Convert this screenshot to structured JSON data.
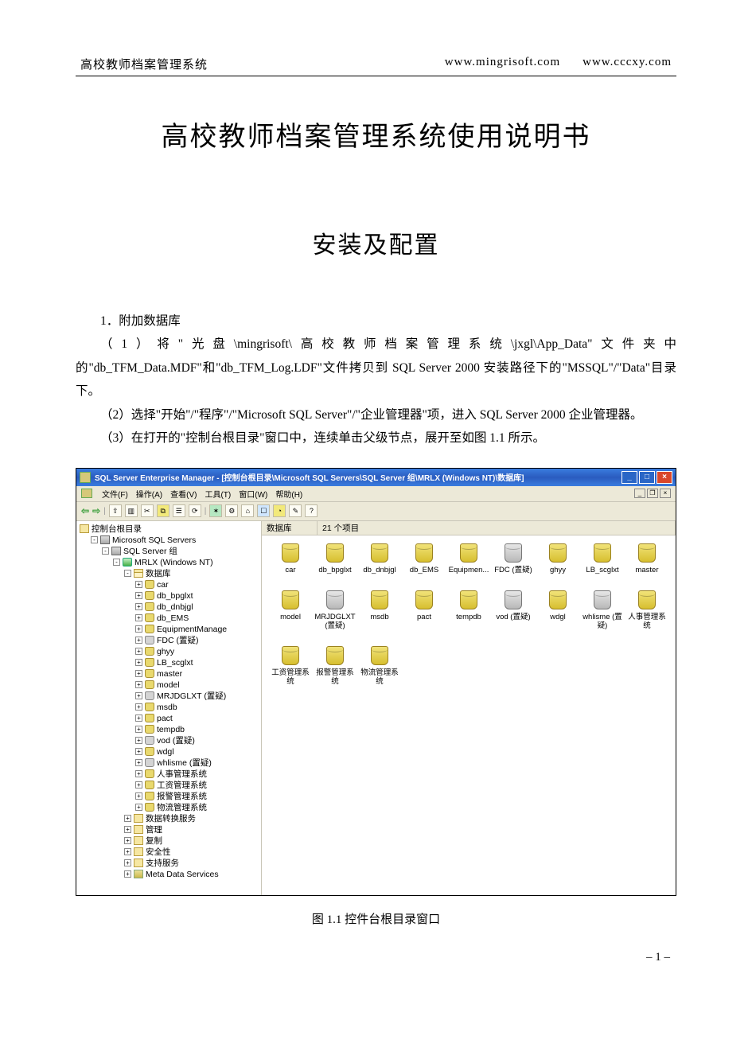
{
  "header": {
    "left": "高校教师档案管理系统",
    "url1": "www.mingrisoft.com",
    "url2": "www.cccxy.com"
  },
  "title": "高校教师档案管理系统使用说明书",
  "subtitle": "安装及配置",
  "section_num": "1．附加数据库",
  "p1": "（1）将\"光盘\\mingrisoft\\高校教师档案管理系统\\jxgl\\App_Data\"文件夹中的\"db_TFM_Data.MDF\"和\"db_TFM_Log.LDF\"文件拷贝到 SQL Server 2000 安装路径下的\"MSSQL\"/\"Data\"目录下。",
  "p2": "（2）选择\"开始\"/\"程序\"/\"Microsoft SQL Server\"/\"企业管理器\"项，进入 SQL Server 2000 企业管理器。",
  "p3": "（3）在打开的\"控制台根目录\"窗口中，连续单击父级节点，展开至如图 1.1 所示。",
  "fig_caption": "图 1.1    控件台根目录窗口",
  "page_number": "– 1 –",
  "ss": {
    "title": "SQL Server Enterprise Manager - [控制台根目录\\Microsoft SQL Servers\\SQL Server 组\\MRLX (Windows NT)\\数据库]",
    "menu": {
      "file": "文件(F)",
      "action": "操作(A)",
      "view": "查看(V)",
      "tools": "工具(T)",
      "window": "窗口(W)",
      "help": "帮助(H)"
    },
    "list_hdr": {
      "c1": "数据库",
      "c2": "21 个项目"
    },
    "tree": {
      "root": "控制台根目录",
      "n1": "Microsoft SQL Servers",
      "n2": "SQL Server 组",
      "n3": "MRLX (Windows NT)",
      "n4": "数据库",
      "dbs": [
        "car",
        "db_bpglxt",
        "db_dnbjgl",
        "db_EMS",
        "EquipmentManage",
        "FDC (置疑)",
        "ghyy",
        "LB_scglxt",
        "master",
        "model",
        "MRJDGLXT (置疑)",
        "msdb",
        "pact",
        "tempdb",
        "vod (置疑)",
        "wdgl",
        "whlisme (置疑)",
        "人事管理系统",
        "工资管理系统",
        "报警管理系统",
        "物流管理系统"
      ],
      "f1": "数据转换服务",
      "f2": "管理",
      "f3": "复制",
      "f4": "安全性",
      "f5": "支持服务",
      "f6": "Meta Data Services"
    },
    "icons": {
      "row1": [
        {
          "n": "car",
          "g": 0
        },
        {
          "n": "db_bpglxt",
          "g": 0
        },
        {
          "n": "db_dnbjgl",
          "g": 0
        },
        {
          "n": "db_EMS",
          "g": 0
        },
        {
          "n": "Equipmen...",
          "g": 0
        },
        {
          "n": "FDC (置疑)",
          "g": 1
        },
        {
          "n": "ghyy",
          "g": 0
        },
        {
          "n": "LB_scglxt",
          "g": 0
        },
        {
          "n": "master",
          "g": 0
        }
      ],
      "row2": [
        {
          "n": "model",
          "g": 0
        },
        {
          "n": "MRJDGLXT (置疑)",
          "g": 1
        },
        {
          "n": "msdb",
          "g": 0
        },
        {
          "n": "pact",
          "g": 0
        },
        {
          "n": "tempdb",
          "g": 0
        },
        {
          "n": "vod (置疑)",
          "g": 1
        },
        {
          "n": "wdgl",
          "g": 0
        },
        {
          "n": "whlisme (置疑)",
          "g": 1
        },
        {
          "n": "人事管理系统",
          "g": 0
        }
      ],
      "row3": [
        {
          "n": "工资管理系统",
          "g": 0
        },
        {
          "n": "报警管理系统",
          "g": 0
        },
        {
          "n": "物流管理系统",
          "g": 0
        }
      ]
    }
  }
}
